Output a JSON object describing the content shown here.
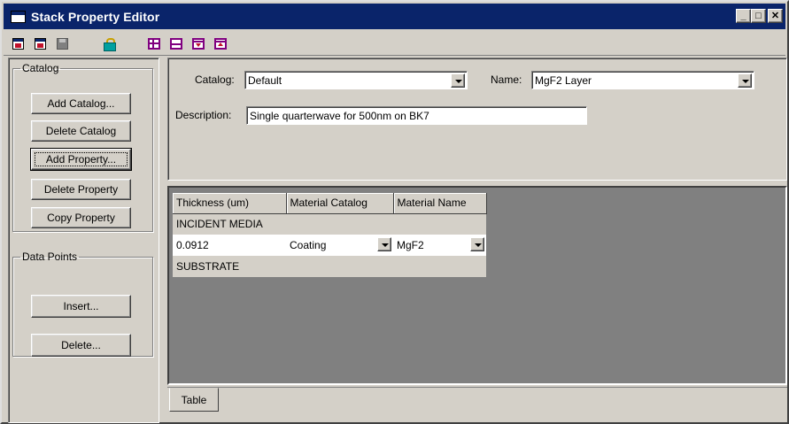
{
  "window": {
    "title": "Stack Property Editor"
  },
  "title_buttons": {
    "minimize": "_",
    "maximize": "□",
    "close": "✕"
  },
  "toolbar": {
    "icons": [
      "generate-icon",
      "generate-report-icon",
      "save-icon",
      "lock-icon",
      "insert-row-icon",
      "append-row-icon",
      "insert-before-icon",
      "insert-after-icon"
    ]
  },
  "catalog_group": {
    "legend": "Catalog",
    "add_catalog": "Add Catalog...",
    "delete_catalog": "Delete Catalog",
    "add_property": "Add  Property...",
    "delete_property": "Delete Property",
    "copy_property": "Copy Property"
  },
  "data_points_group": {
    "legend": "Data Points",
    "insert": "Insert...",
    "delete": "Delete..."
  },
  "form": {
    "catalog_label": "Catalog:",
    "catalog_value": "Default",
    "name_label": "Name:",
    "name_value": "MgF2 Layer",
    "description_label": "Description:",
    "description_value": "Single quarterwave for 500nm on BK7"
  },
  "grid": {
    "headers": [
      "Thickness (um)",
      "Material Catalog",
      "Material Name"
    ],
    "incident_row": "INCIDENT MEDIA",
    "layer_row": {
      "thickness": "0.0912",
      "material_catalog": "Coating",
      "material_name": "MgF2"
    },
    "substrate_row": "SUBSTRATE"
  },
  "tabs": {
    "table": "Table"
  },
  "colors": {
    "titlebar": "#0a246a",
    "face": "#d4d0c8",
    "grid_bg": "#808080"
  }
}
